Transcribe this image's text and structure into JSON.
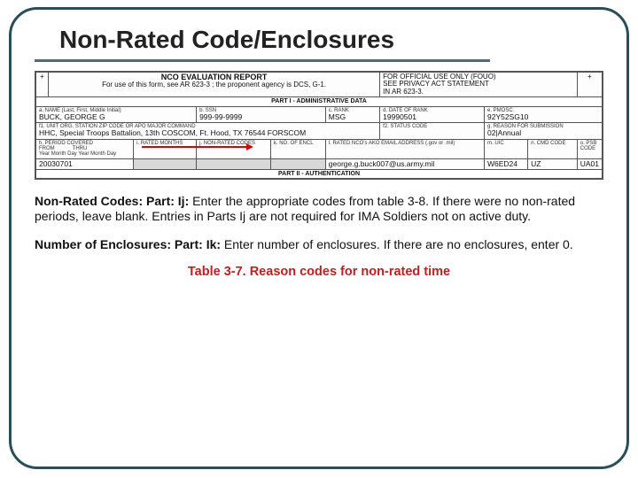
{
  "title": "Non-Rated Code/Enclosures",
  "form": {
    "header_left": "NCO EVALUATION REPORT",
    "header_sub": "For use of this form, see  AR 623-3 ; the proponent agency is DCS, G-1.",
    "header_right_l1": "FOR OFFICIAL USE ONLY (FOUO)",
    "header_right_l2": "SEE PRIVACY ACT STATEMENT",
    "header_right_l3": "IN AR 623-3.",
    "part1": "PART I - ADMINISTRATIVE DATA",
    "a_label": "a. NAME (Last, First, Middle Initial)",
    "a_val": "BUCK, GEORGE G",
    "b_label": "b. SSN",
    "b_val": "999-99-9999",
    "c_label": "c. RANK",
    "c_val": "MSG",
    "d_label": "d. DATE OF RANK",
    "d_val": "19990501",
    "e_label": "e. PMOSC",
    "e_val": "92Y52SG10",
    "f1_label": "f1. UNIT               ORG.               STATION               ZIP CODE OR APO               MAJOR COMMAND",
    "f1_val": "HHC, Special Troops Battalion, 13th COSCOM, Ft. Hood, TX 76544   FORSCOM",
    "f2_label": "f2. STATUS CODE",
    "g_label": "g. REASON FOR SUBMISSION",
    "g_val": "02|Annual",
    "h_label": "h. PERIOD COVERED",
    "h_from": "FROM",
    "h_thru": "THRU",
    "h_dateline": "Year   Month   Day         Year   Month   Day",
    "h_val": "20030701",
    "i_label": "i. RATED MONTHS",
    "j_label": "j. NON-RATED CODES",
    "k_label": "k. NO. OF ENCL",
    "l_label": "l. RATED NCO's AKO EMAIL ADDRESS (.gov or .mil)",
    "l_val": "george.g.buck007@us.army.mil",
    "m_label": "m. UIC",
    "m_val": "W6ED24",
    "n_label": "n. CMD CODE",
    "n_val": "UZ",
    "o_label": "o. PSB CODE",
    "o_val": "UA01",
    "part2": "PART II - AUTHENTICATION"
  },
  "para1_prefix": "Non-Rated Codes: Part: Ij:",
  "para1_rest": " Enter the appropriate codes from table 3-8. If there were no non-rated periods, leave blank. Entries in Parts Ij are not required for IMA Soldiers not on active duty.",
  "para2_prefix": "Number of Enclosures: Part: Ik:",
  "para2_rest": " Enter number of enclosures. If there are no enclosures, enter 0.",
  "footer": "Table 3-7. Reason codes for non-rated time"
}
